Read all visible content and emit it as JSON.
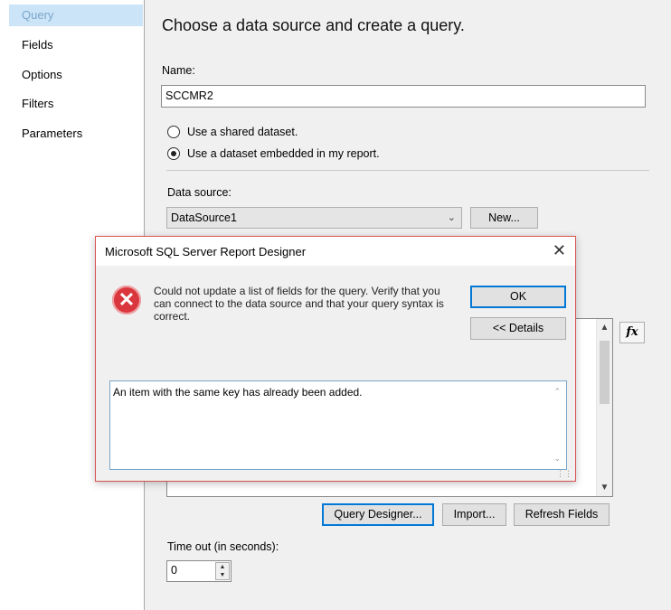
{
  "sidebar": {
    "items": [
      {
        "label": "Query"
      },
      {
        "label": "Fields"
      },
      {
        "label": "Options"
      },
      {
        "label": "Filters"
      },
      {
        "label": "Parameters"
      }
    ]
  },
  "main": {
    "heading": "Choose a data source and create a query.",
    "name_label": "Name:",
    "name_value": "SCCMR2",
    "radio_shared": "Use a shared dataset.",
    "radio_embedded": "Use a dataset embedded in my report.",
    "data_source_label": "Data source:",
    "data_source_value": "DataSource1",
    "new_button": "New...",
    "query_designer_button": "Query Designer...",
    "import_button": "Import...",
    "refresh_fields_button": "Refresh Fields",
    "timeout_label": "Time out (in seconds):",
    "timeout_value": "0"
  },
  "dialog": {
    "title": "Microsoft SQL Server Report Designer",
    "message": "Could not update a list of fields for the query. Verify that you can connect to the data source and that your query syntax is correct.",
    "ok_button": "OK",
    "details_button": "<< Details",
    "details_text": "An item with the same key has already been added.",
    "close_glyph": "✕",
    "error_glyph": "✕"
  },
  "icons": {
    "dropdown": "chevron-down-icon",
    "error": "error-icon",
    "expression": "fx-icon"
  },
  "colors": {
    "selected_nav_bg": "#cce4f7",
    "dialog_border": "#d9534f",
    "primary_button_border": "#0078d7",
    "error_icon": "#d9363e"
  }
}
